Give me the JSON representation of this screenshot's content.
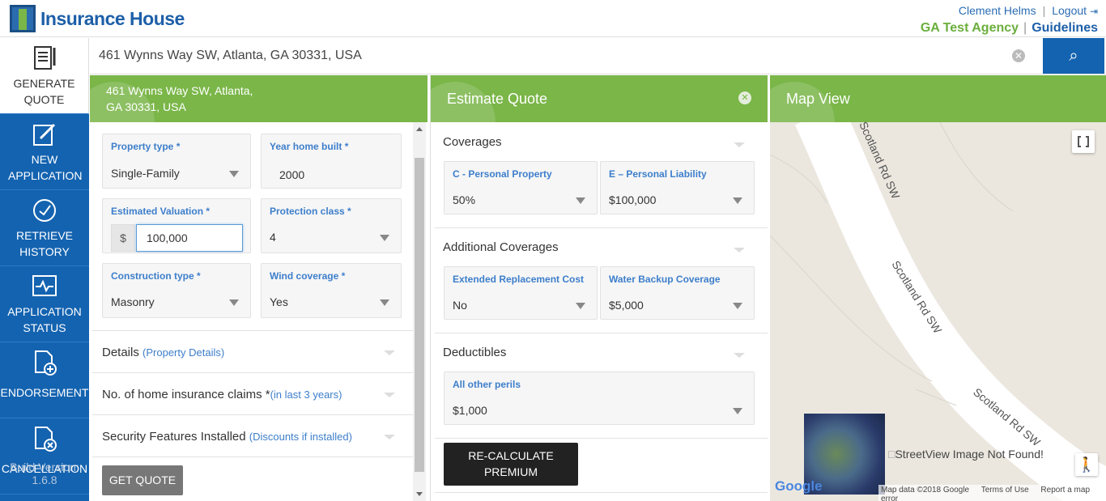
{
  "header": {
    "brand": "Insurance House",
    "user": "Clement Helms",
    "logout": "Logout",
    "agency": "GA Test Agency",
    "guidelines": "Guidelines",
    "sep": "|"
  },
  "sidebar": {
    "items": [
      {
        "label": "GENERATE QUOTE"
      },
      {
        "label": "NEW APPLICATION"
      },
      {
        "label": "RETRIEVE HISTORY"
      },
      {
        "label": "APPLICATION STATUS"
      },
      {
        "label": "ENDORSEMENT"
      },
      {
        "label": "CANCELLATION"
      }
    ],
    "build_version": "Build Version: 1.6.8"
  },
  "search": {
    "value": "461 Wynns Way SW, Atlanta, GA 30331, USA"
  },
  "property_panel": {
    "title_line1": "461 Wynns Way SW, Atlanta,",
    "title_line2": "GA 30331, USA",
    "fields": {
      "property_type": {
        "label": "Property type *",
        "value": "Single-Family"
      },
      "year_built": {
        "label": "Year home built *",
        "value": "2000"
      },
      "valuation": {
        "label": "Estimated Valuation *",
        "currency": "$",
        "value": "100,000"
      },
      "protection_class": {
        "label": "Protection class *",
        "value": "4"
      },
      "construction_type": {
        "label": "Construction type *",
        "value": "Masonry"
      },
      "wind_coverage": {
        "label": "Wind coverage *",
        "value": "Yes"
      }
    },
    "sections": [
      {
        "title": "Details",
        "sub": "(Property Details)"
      },
      {
        "title": "No. of home insurance claims *",
        "sub": "(in last 3 years)"
      },
      {
        "title": "Security Features Installed",
        "sub": "(Discounts if installed)"
      }
    ],
    "get_quote": "GET QUOTE"
  },
  "estimate_panel": {
    "title": "Estimate Quote",
    "coverages": {
      "title": "Coverages",
      "c_label": "C - Personal Property",
      "c_value": "50%",
      "e_label": "E – Personal Liability",
      "e_value": "$100,000"
    },
    "additional": {
      "title": "Additional Coverages",
      "erc_label": "Extended Replacement Cost",
      "erc_value": "No",
      "wb_label": "Water Backup Coverage",
      "wb_value": "$5,000"
    },
    "deductibles": {
      "title": "Deductibles",
      "label": "All other perils",
      "value": "$1,000"
    },
    "recalc_line1": "RE-CALCULATE",
    "recalc_line2": "PREMIUM"
  },
  "map_panel": {
    "title": "Map View",
    "road1": "Scotland Rd SW",
    "road2": "Scotland Rd SW",
    "road3": "Scotland Rd SW",
    "streetview_alt": "StreetView Image Not Found!",
    "google": "Google",
    "map_data": "Map data ©2018 Google",
    "terms": "Terms of Use",
    "report": "Report a map error"
  }
}
